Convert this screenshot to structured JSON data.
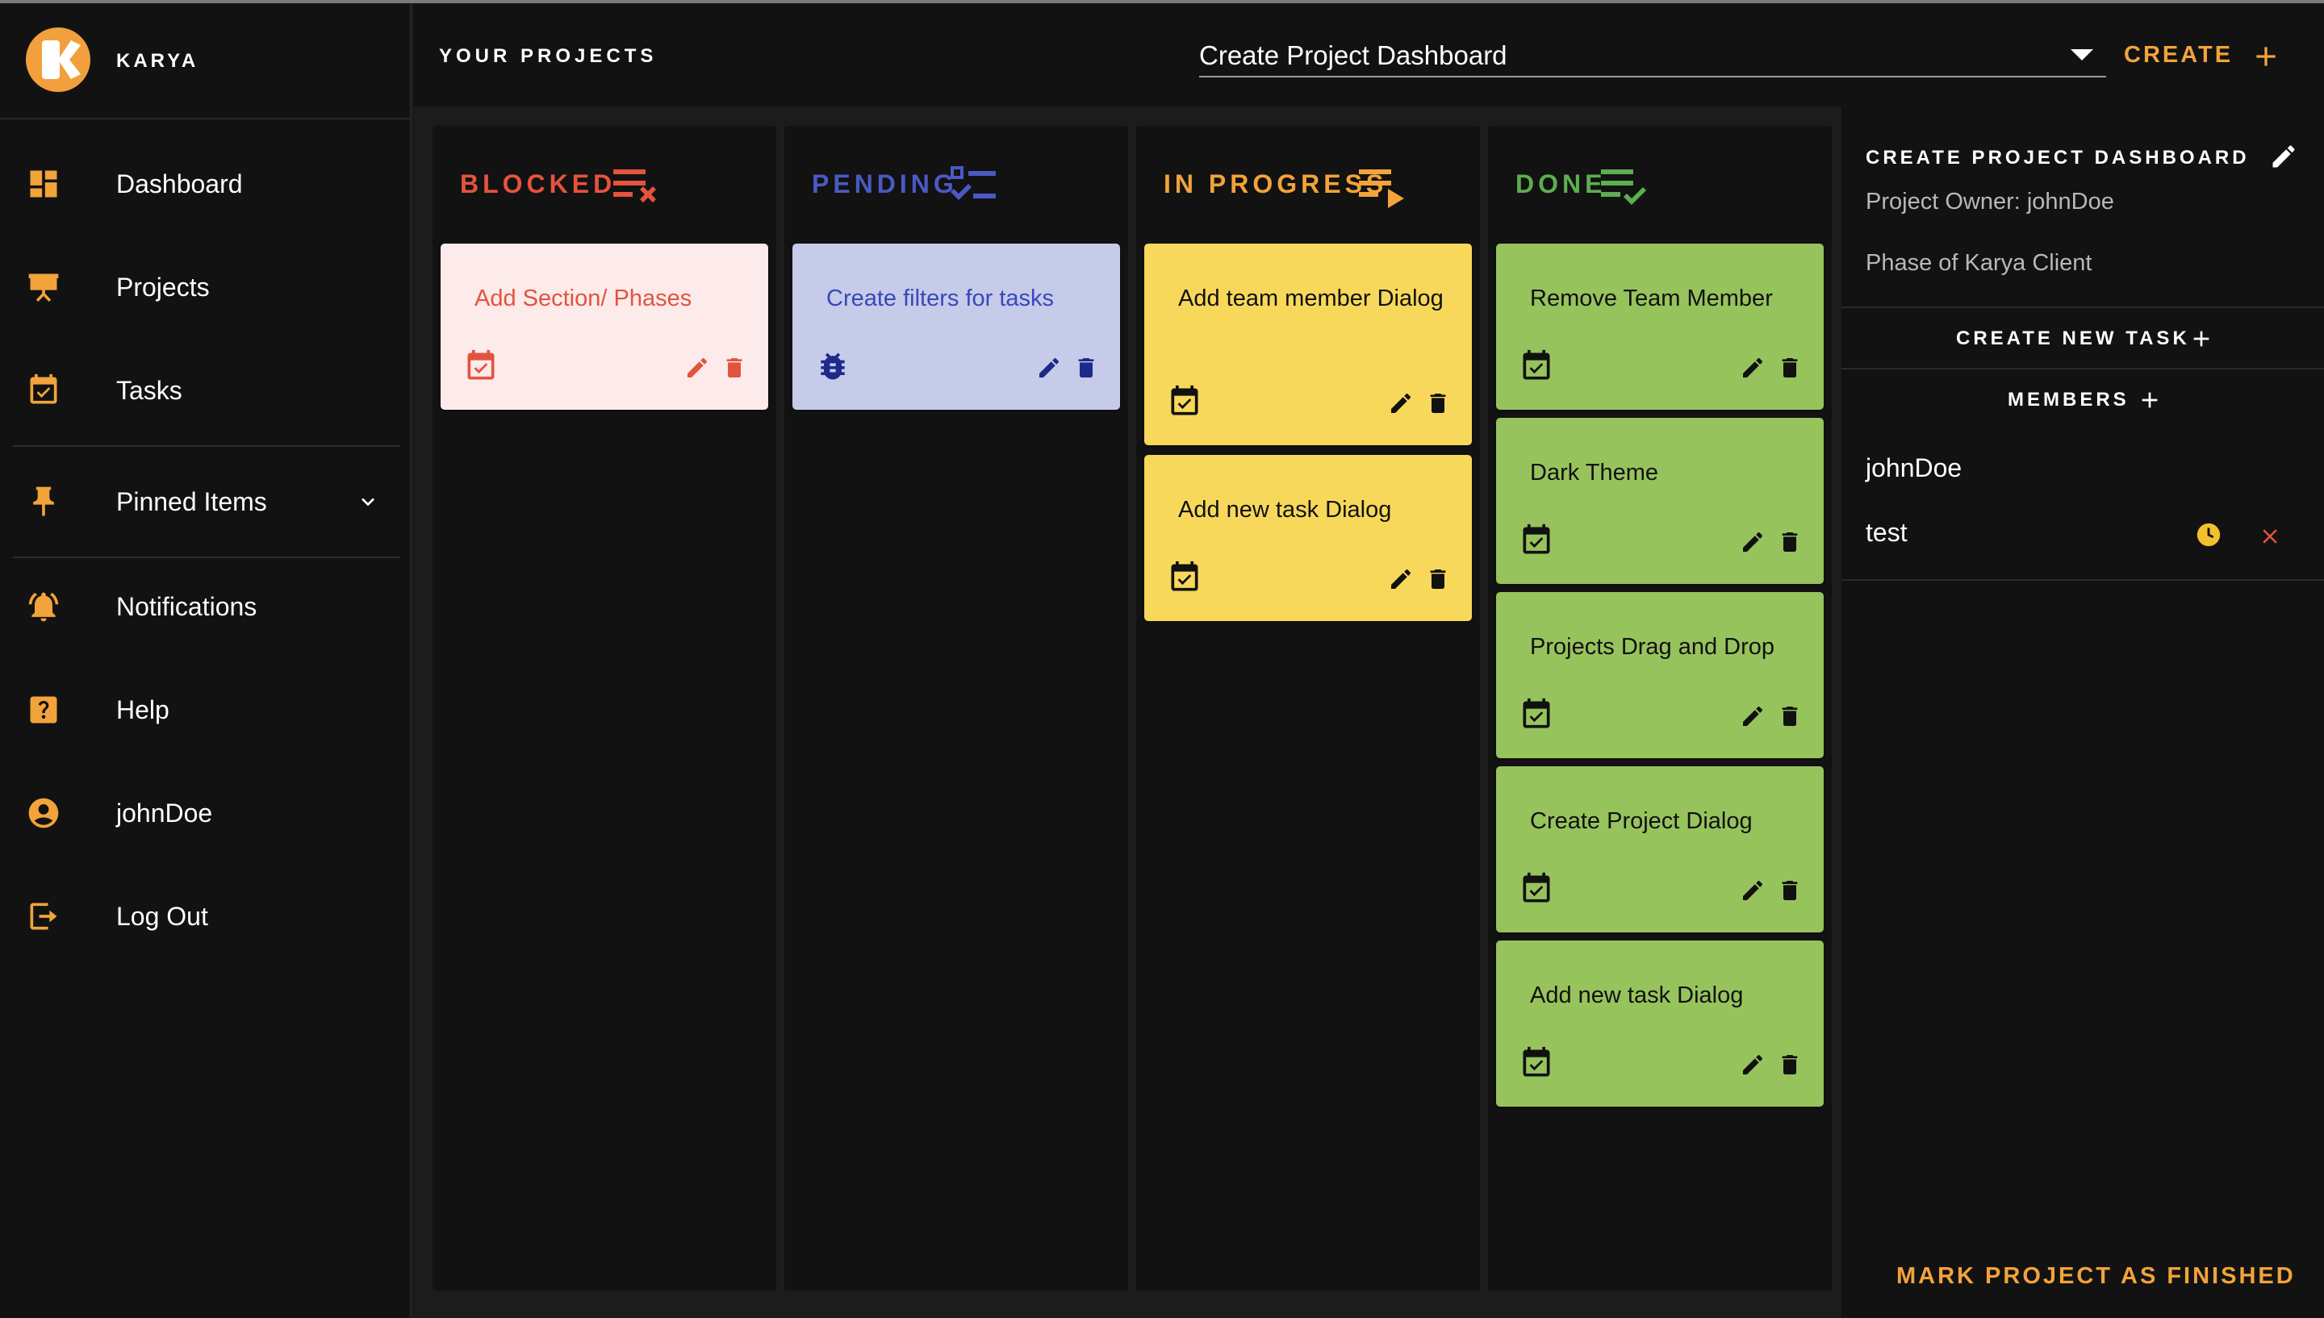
{
  "app": {
    "name": "KARYA",
    "accent": "#f2a33a"
  },
  "sidebar": {
    "items": [
      {
        "label": "Dashboard",
        "icon": "dashboard-icon"
      },
      {
        "label": "Projects",
        "icon": "presentation-icon"
      },
      {
        "label": "Tasks",
        "icon": "calendar-check-icon"
      },
      {
        "label": "Pinned Items",
        "icon": "pin-icon"
      },
      {
        "label": "Notifications",
        "icon": "bell-icon"
      },
      {
        "label": "Help",
        "icon": "help-icon"
      },
      {
        "label": "johnDoe",
        "icon": "account-icon"
      },
      {
        "label": "Log Out",
        "icon": "logout-icon"
      }
    ]
  },
  "topbar": {
    "section_label": "YOUR PROJECTS",
    "selected_project": "Create Project Dashboard",
    "create_label": "CREATE"
  },
  "board": {
    "columns": [
      {
        "title": "BLOCKED",
        "color": "#e5533d",
        "icon": "list-x-icon",
        "cards": [
          {
            "title": "Add Section/ Phases",
            "icon": "calendar-check-icon",
            "bg": "#fdeaea",
            "fg": "#e0553e"
          }
        ]
      },
      {
        "title": "PENDING",
        "color": "#4b59c4",
        "icon": "checklist-icon",
        "cards": [
          {
            "title": "Create filters for tasks",
            "icon": "bug-icon",
            "bg": "#c6cbea",
            "fg": "#3948b8"
          }
        ]
      },
      {
        "title": "IN PROGRESS",
        "color": "#f2a33a",
        "icon": "playlist-play-icon",
        "cards": [
          {
            "title": "Add team member Dialog",
            "icon": "calendar-check-icon",
            "bg": "#f8d85b",
            "fg": "#111111"
          },
          {
            "title": "Add new task Dialog",
            "icon": "calendar-check-icon",
            "bg": "#f8d85b",
            "fg": "#111111"
          }
        ]
      },
      {
        "title": "DONE",
        "color": "#5cae4f",
        "icon": "playlist-check-icon",
        "cards": [
          {
            "title": "Remove Team Member",
            "icon": "calendar-check-icon",
            "bg": "#97c35d",
            "fg": "#111111"
          },
          {
            "title": "Dark Theme",
            "icon": "calendar-check-icon",
            "bg": "#97c35d",
            "fg": "#111111"
          },
          {
            "title": "Projects Drag and Drop",
            "icon": "calendar-check-icon",
            "bg": "#97c35d",
            "fg": "#111111"
          },
          {
            "title": "Create Project Dialog",
            "icon": "calendar-check-icon",
            "bg": "#97c35d",
            "fg": "#111111"
          },
          {
            "title": "Add new task Dialog",
            "icon": "calendar-check-icon",
            "bg": "#97c35d",
            "fg": "#111111"
          }
        ]
      }
    ]
  },
  "panel": {
    "title": "CREATE PROJECT DASHBOARD",
    "owner": "Project Owner: johnDoe",
    "description": "Phase of Karya Client",
    "create_task_label": "CREATE NEW TASK",
    "members_label": "MEMBERS",
    "members": [
      {
        "name": "johnDoe"
      },
      {
        "name": "test",
        "status_color": "#f2c12e",
        "remove_color": "#e5533d"
      }
    ],
    "finish_label": "MARK PROJECT AS FINISHED"
  }
}
